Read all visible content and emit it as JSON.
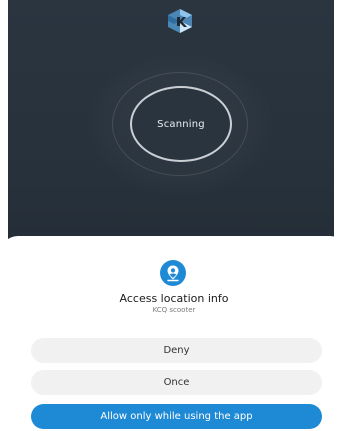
{
  "scanner": {
    "status_label": "Scanning",
    "logo_icon": "kcq-logo-icon"
  },
  "permission_dialog": {
    "icon": "location-person-icon",
    "title": "Access location info",
    "app_name": "KCQ scooter",
    "buttons": {
      "deny": "Deny",
      "once": "Once",
      "allow": "Allow only while using the app"
    }
  },
  "colors": {
    "accent": "#1e8ad6",
    "background_dark": "#27313b",
    "sheet_background": "#ffffff",
    "secondary_button": "#f1f1f1"
  }
}
